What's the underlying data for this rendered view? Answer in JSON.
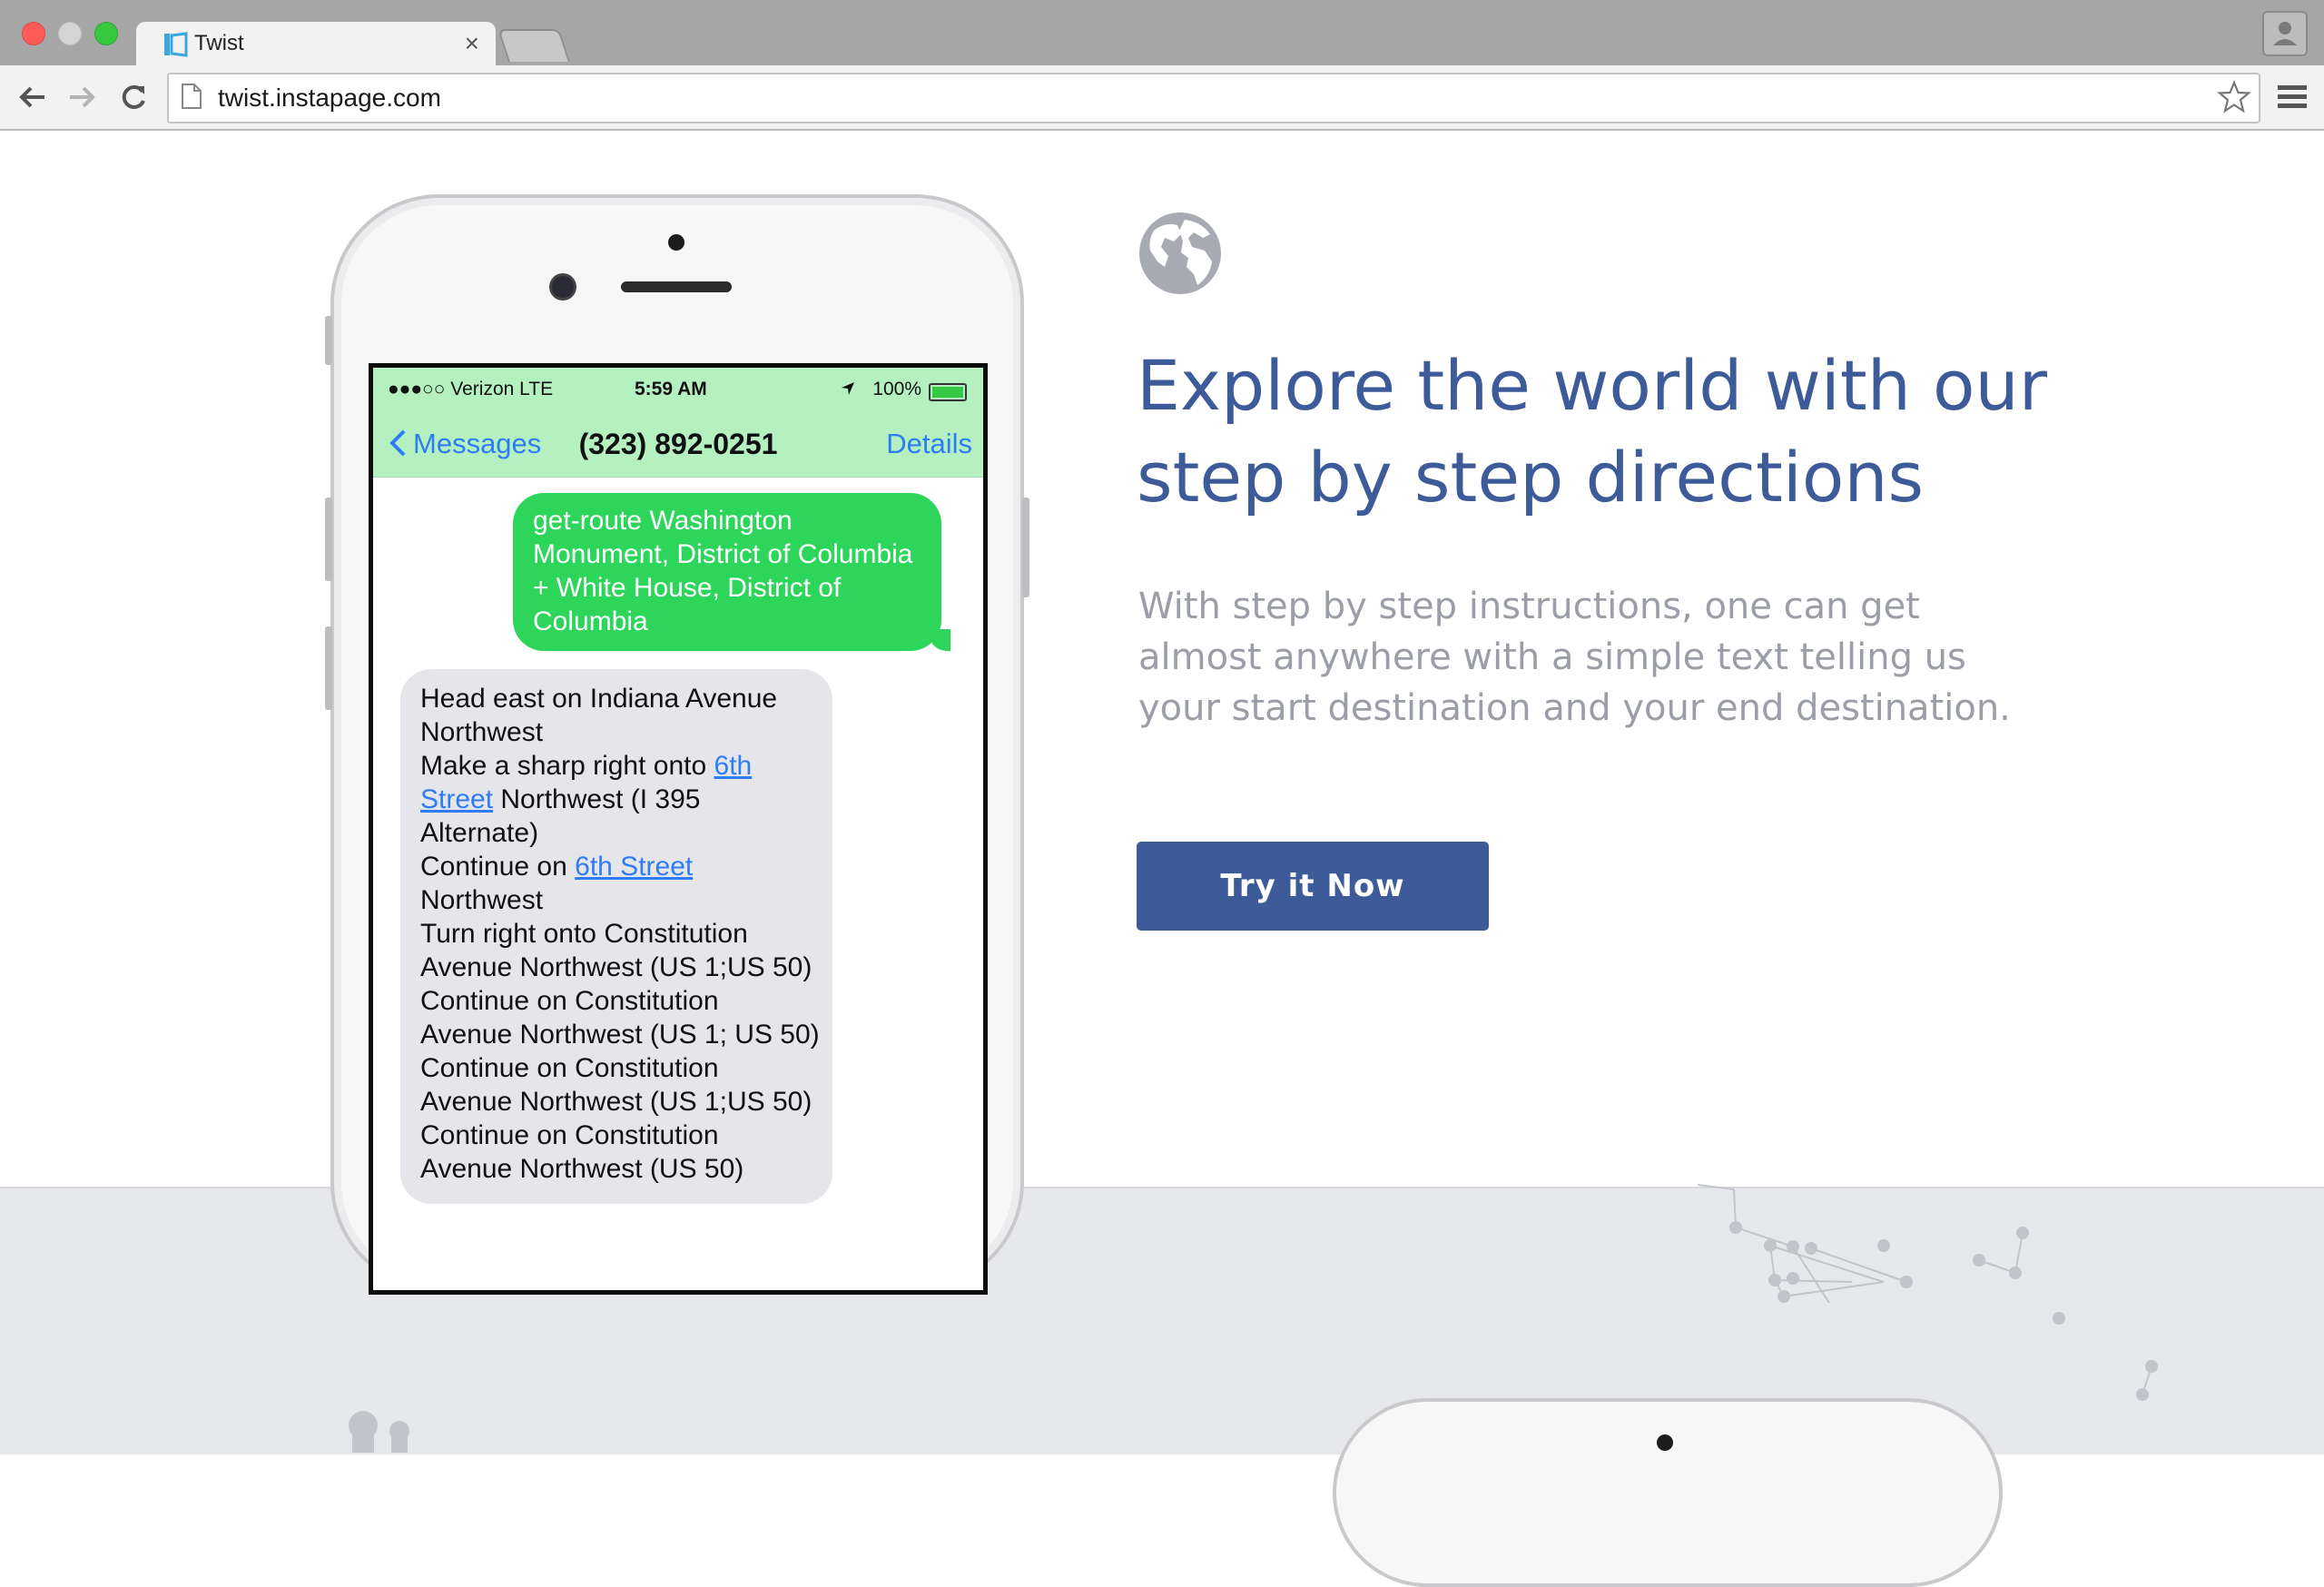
{
  "browser": {
    "tab_title": "Twist",
    "tab_close": "×",
    "url": "twist.instapage.com"
  },
  "phone": {
    "status": {
      "carrier": "●●●○○ Verizon  LTE",
      "time": "5:59 AM",
      "battery": "100%"
    },
    "nav": {
      "back": "Messages",
      "contact": "(323) 892-0251",
      "details": "Details"
    },
    "outgoing": [
      "get-route Washington",
      "Monument, District of Columbia",
      "+ White House, District of",
      "Columbia"
    ],
    "incoming": {
      "l1": "Head east on Indiana Avenue",
      "l2": "Northwest",
      "l3a": "Make a sharp right onto ",
      "l3b": "6th",
      "l4a": "Street",
      "l4b": " Northwest (I 395",
      "l5": "Alternate)",
      "l6a": "Continue on ",
      "l6b": "6th Street",
      "l7": "Northwest",
      "l8": "Turn right onto Constitution",
      "l9": "Avenue Northwest (US 1;US 50)",
      "l10": "Continue on Constitution",
      "l11": "Avenue Northwest (US 1; US 50)",
      "l12": "Continue on Constitution",
      "l13": "Avenue Northwest (US 1;US 50)",
      "l14": "Continue on Constitution",
      "l15": "Avenue Northwest (US 50)"
    }
  },
  "content": {
    "headline": "Explore the world with our step by step directions",
    "body": "With step by step instructions, one can get almost anywhere with a simple text telling us your start destination and your end destination.",
    "cta": "Try it Now"
  },
  "icons": [
    "twist-logo-icon",
    "back-arrow-icon",
    "forward-arrow-icon",
    "reload-icon",
    "page-icon",
    "bookmark-star-icon",
    "menu-icon",
    "profile-icon",
    "globe-icon",
    "location-arrow-icon",
    "battery-icon",
    "chevron-left-icon"
  ],
  "colors": {
    "brand": "#3d5a99",
    "imessage_green": "#2dd55b",
    "link_blue": "#2e7cf6",
    "band": "#e7e8ec"
  }
}
